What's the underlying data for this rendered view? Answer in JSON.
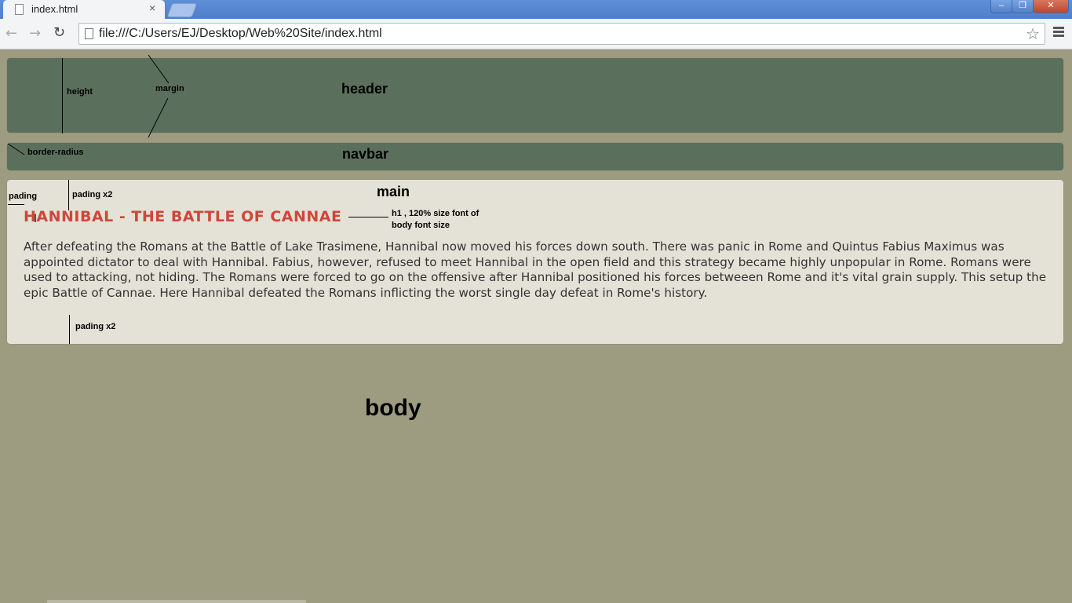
{
  "browser": {
    "tab_title": "index.html",
    "tab_close": "×",
    "url": "file:///C:/Users/EJ/Desktop/Web%20Site/index.html",
    "back_icon": "←",
    "forward_icon": "→",
    "reload_icon": "↻",
    "star_icon": "☆",
    "window_min": "–",
    "window_max": "❐",
    "window_close": "✕"
  },
  "page": {
    "header_label": "header",
    "navbar_label": "navbar",
    "main_label": "main",
    "body_label": "body",
    "h1": "HANNIBAL - THE BATTLE OF CANNAE",
    "paragraph": "After defeating the Romans at the Battle of Lake Trasimene, Hannibal now moved his forces down south. There was panic in Rome and Quintus Fabius Maximus was appointed dictator to deal with Hannibal. Fabius, however, refused to meet Hannibal in the open field and this strategy became highly unpopular in Rome. Romans were used to attacking, not hiding. The Romans were forced to go on the offensive after Hannibal positioned his forces betweeen Rome and it's vital grain supply. This setup the epic Battle of Cannae. Here Hannibal defeated the Romans inflicting the worst single day defeat in Rome's history."
  },
  "annotations": {
    "height": "height",
    "margin": "margin",
    "border_radius": "border-radius",
    "pading": "pading",
    "pading_x2_top": "pading  x2",
    "pading_x2_bottom": "pading  x2",
    "h1_note_line1": "h1 , 120% size font of",
    "h1_note_line2": "body font size"
  },
  "colors": {
    "body_bg": "#9d9c81",
    "header_bg": "#5b705c",
    "main_bg": "#e4e2d6",
    "h1_color": "#d0463b"
  }
}
